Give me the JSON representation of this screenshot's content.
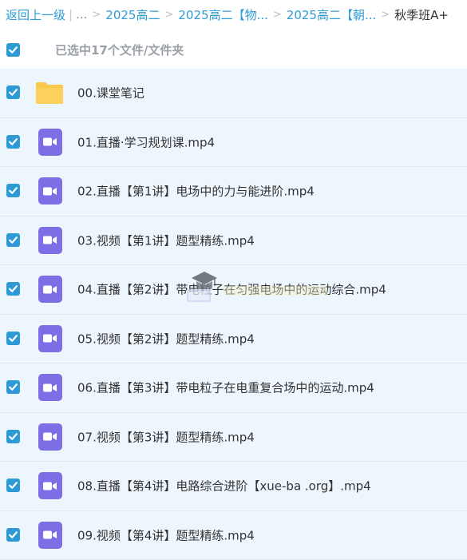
{
  "breadcrumb": {
    "back_label": "返回上一级",
    "ellipsis": "...",
    "items": [
      "2025高二",
      "2025高二【物...",
      "2025高二【朝..."
    ],
    "current": "秋季班A+"
  },
  "selection": {
    "summary": "已选中17个文件/文件夹"
  },
  "files": [
    {
      "name": "00.课堂笔记",
      "type": "folder"
    },
    {
      "name": "01.直播·学习规划课.mp4",
      "type": "video"
    },
    {
      "name": "02.直播【第1讲】电场中的力与能进阶.mp4",
      "type": "video"
    },
    {
      "name": "03.视频【第1讲】题型精练.mp4",
      "type": "video"
    },
    {
      "name": "04.直播【第2讲】带电粒子在匀强电场中的运动综合.mp4",
      "type": "video"
    },
    {
      "name": "05.视频【第2讲】题型精练.mp4",
      "type": "video"
    },
    {
      "name": "06.直播【第3讲】带电粒子在电重复合场中的运动.mp4",
      "type": "video"
    },
    {
      "name": "07.视频【第3讲】题型精练.mp4",
      "type": "video"
    },
    {
      "name": "08.直播【第4讲】电路综合进阶【xue-ba .org】.mp4",
      "type": "video"
    },
    {
      "name": "09.视频【第4讲】题型精练.mp4",
      "type": "video"
    }
  ],
  "colors": {
    "accent": "#2d9ad6",
    "link": "#2e9cd6",
    "row_background": "#eef6fd",
    "video_icon": "#7e6ee5",
    "folder_icon": "#f9c94b"
  }
}
